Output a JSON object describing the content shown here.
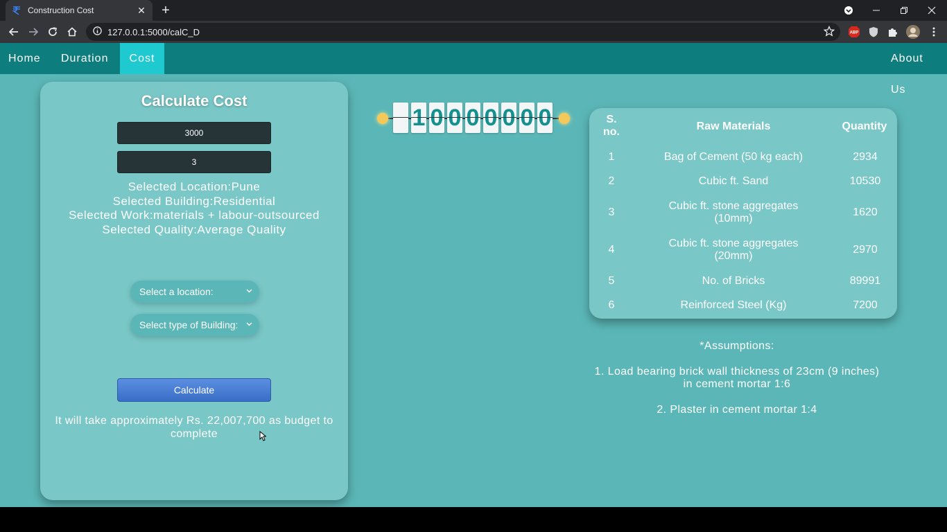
{
  "browser": {
    "tab_title": "Construction Cost",
    "url": "127.0.0.1:5000/calC_D"
  },
  "nav": {
    "home": "Home",
    "duration": "Duration",
    "cost": "Cost",
    "about": "About Us"
  },
  "form": {
    "heading": "Calculate Cost",
    "input1_value": "3000",
    "input2_value": "3",
    "selected_location": "Selected Location:Pune",
    "selected_building": "Selected Building:Residential",
    "selected_work": "Selected Work:materials + labour-outsourced",
    "selected_quality": "Selected Quality:Average Quality",
    "location_select": "Select a location:",
    "building_select": "Select type of Building:",
    "calculate_label": "Calculate",
    "budget_line1": "It will take approximately Rs. 22,007,700 as budget to",
    "budget_line2": "complete"
  },
  "counter": {
    "digits": [
      "",
      "1",
      "0",
      "0",
      "0",
      "0",
      "0",
      "0",
      "0"
    ]
  },
  "table": {
    "headers": {
      "sno_1": "S.",
      "sno_2": "no.",
      "materials": "Raw Materials",
      "quantity": "Quantity"
    },
    "rows": [
      {
        "sno": "1",
        "material": "Bag of Cement (50 kg each)",
        "material2": "",
        "qty": "2934"
      },
      {
        "sno": "2",
        "material": "Cubic ft. Sand",
        "material2": "",
        "qty": "10530"
      },
      {
        "sno": "3",
        "material": "Cubic ft. stone aggregates",
        "material2": "(10mm)",
        "qty": "1620"
      },
      {
        "sno": "4",
        "material": "Cubic ft. stone aggregates",
        "material2": "(20mm)",
        "qty": "2970"
      },
      {
        "sno": "5",
        "material": "No. of Bricks",
        "material2": "",
        "qty": "89991"
      },
      {
        "sno": "6",
        "material": "Reinforced Steel (Kg)",
        "material2": "",
        "qty": "7200"
      }
    ]
  },
  "assumptions": {
    "title": "*Assumptions:",
    "item1_line1": "1. Load bearing brick wall thickness of 23cm (9 inches)",
    "item1_line2": "in cement mortar 1:6",
    "item2": "2. Plaster in cement mortar 1:4"
  }
}
